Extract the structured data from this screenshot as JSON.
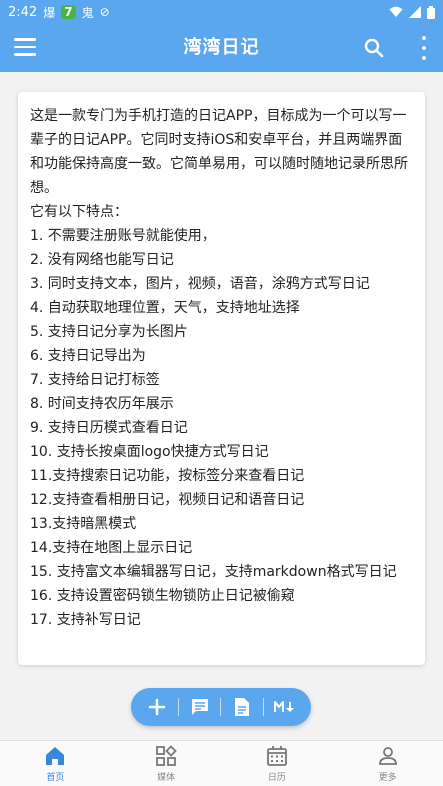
{
  "status": {
    "time": "2:42",
    "app1": "爆",
    "badge": "7",
    "app2": "鬼"
  },
  "header": {
    "title": "湾湾日记"
  },
  "content": {
    "intro": "这是一款专门为手机打造的日记APP，目标成为一个可以写一辈子的日记APP。它同时支持iOS和安卓平台，并且两端界面和功能保持高度一致。它简单易用，可以随时随地记录所思所想。",
    "features_title": "它有以下特点：",
    "features": [
      "1. 不需要注册账号就能使用，",
      "2. 没有网络也能写日记",
      "3. 同时支持文本，图片，视频，语音，涂鸦方式写日记",
      "4. 自动获取地理位置，天气，支持地址选择",
      "5.  支持日记分享为长图片",
      "6.  支持日记导出为",
      "7. 支持给日记打标签",
      "8. 时间支持农历年展示",
      "9. 支持日历模式查看日记",
      "10. 支持长按桌面logo快捷方式写日记",
      "11.支持搜索日记功能，按标签分来查看日记",
      "12.支持查看相册日记，视频日记和语音日记",
      "13.支持暗黑模式",
      "14.支持在地图上显示日记",
      "15. 支持富文本编辑器写日记，支持markdown格式写日记",
      "16. 支持设置密码锁生物锁防止日记被偷窥",
      "17. 支持补写日记"
    ]
  },
  "nav": {
    "home": "首页",
    "media": "媒体",
    "calendar": "日历",
    "more": "更多"
  },
  "colors": {
    "accent": "#5aa7ef",
    "active": "#3a86d9"
  }
}
